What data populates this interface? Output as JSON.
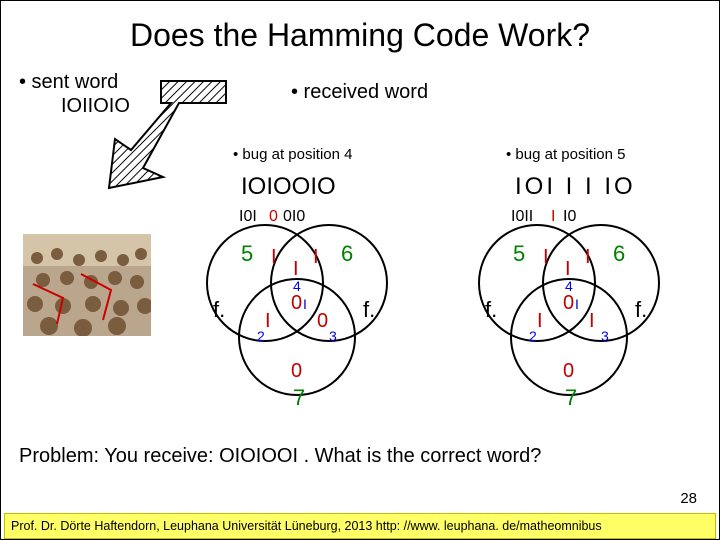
{
  "title": "Does the Hamming Code Work?",
  "sent": {
    "label": "• sent word",
    "word": "IOIIOIO"
  },
  "received": {
    "label": "• received word"
  },
  "bug4": {
    "label": "• bug at position 4",
    "word": "IOIOOIO"
  },
  "bug5": {
    "label": "• bug at position 5",
    "word": "IOI I I IO"
  },
  "problem": "Problem: You receive: OIOIOOI . What is the correct word?",
  "page": "28",
  "footer": "Prof. Dr. Dörte Haftendorn, Leuphana Universität Lüneburg, 2013 http: //www. leuphana. de/matheomnibus",
  "venn_left": {
    "top_left": {
      "outer": "5",
      "inner": "I"
    },
    "top_right": {
      "outer": "6",
      "inner": "I"
    },
    "bottom": {
      "outer": "7",
      "inner": "0"
    },
    "mid_top": "I",
    "mid_left": "I",
    "mid_right": "0",
    "center": "0",
    "label_top": "4",
    "label_left": "2",
    "label_right": "3",
    "label_center": "I",
    "f_left": "f.",
    "f_right": "f."
  },
  "venn_right": {
    "top_left": {
      "outer": "5",
      "inner": "I"
    },
    "top_right": {
      "outer": "6",
      "inner": "I"
    },
    "bottom": {
      "outer": "7",
      "inner": "0"
    },
    "mid_top": "I",
    "mid_left": "I",
    "mid_right": "I",
    "center": "0",
    "label_top": "4",
    "label_left": "2",
    "label_right": "3",
    "label_center": "I",
    "f_left": "f.",
    "f_right": "f."
  }
}
